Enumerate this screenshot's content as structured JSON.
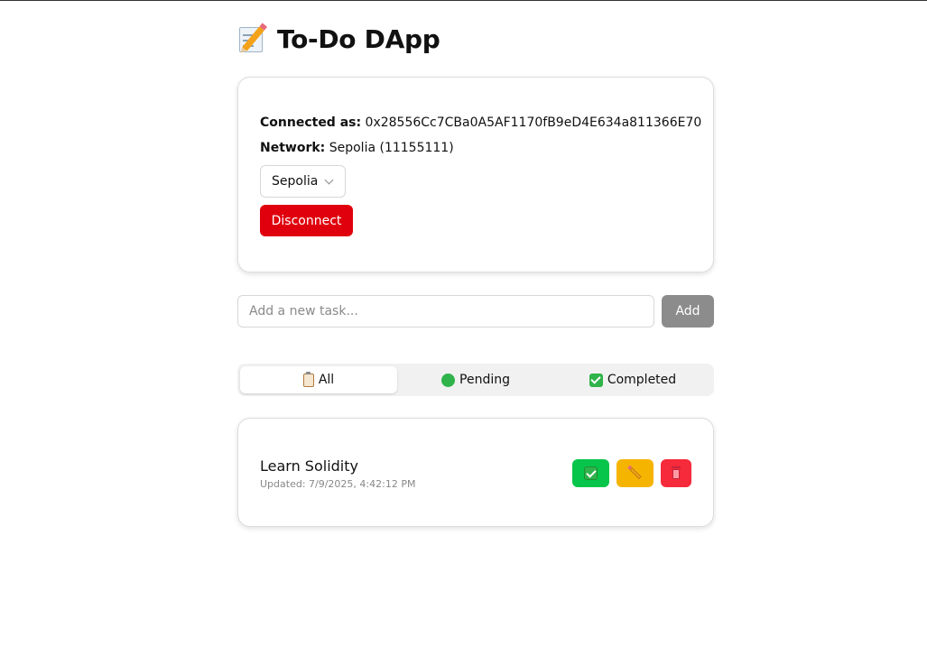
{
  "app": {
    "title": "To-Do DApp",
    "title_icon": "memo-pencil-icon"
  },
  "connection": {
    "connected_label": "Connected as:",
    "address": "0x28556Cc7CBa0A5AF1170fB9eD4E634a811366E70",
    "network_label": "Network:",
    "network_value": "Sepolia (11155111)",
    "network_select_value": "Sepolia",
    "disconnect_label": "Disconnect",
    "disconnect_color": "#e0000d"
  },
  "new_task": {
    "placeholder": "Add a new task...",
    "value": "",
    "add_label": "Add",
    "add_color": "#8c8c8c"
  },
  "filters": {
    "tabs": [
      {
        "label": "All",
        "icon": "clipboard-icon",
        "active": true
      },
      {
        "label": "Pending",
        "icon": "green-circle-icon",
        "active": false
      },
      {
        "label": "Completed",
        "icon": "check-mark-button-icon",
        "active": false
      }
    ]
  },
  "tasks": [
    {
      "title": "Learn Solidity",
      "updated": "Updated: 7/9/2025, 4:42:12 PM",
      "actions": [
        {
          "name": "complete",
          "icon": "check-mark-button-icon",
          "color": "#06c54a"
        },
        {
          "name": "edit",
          "icon": "pencil-icon",
          "color": "#f5b400"
        },
        {
          "name": "delete",
          "icon": "wastebasket-icon",
          "color": "#f52a3a"
        }
      ]
    }
  ]
}
